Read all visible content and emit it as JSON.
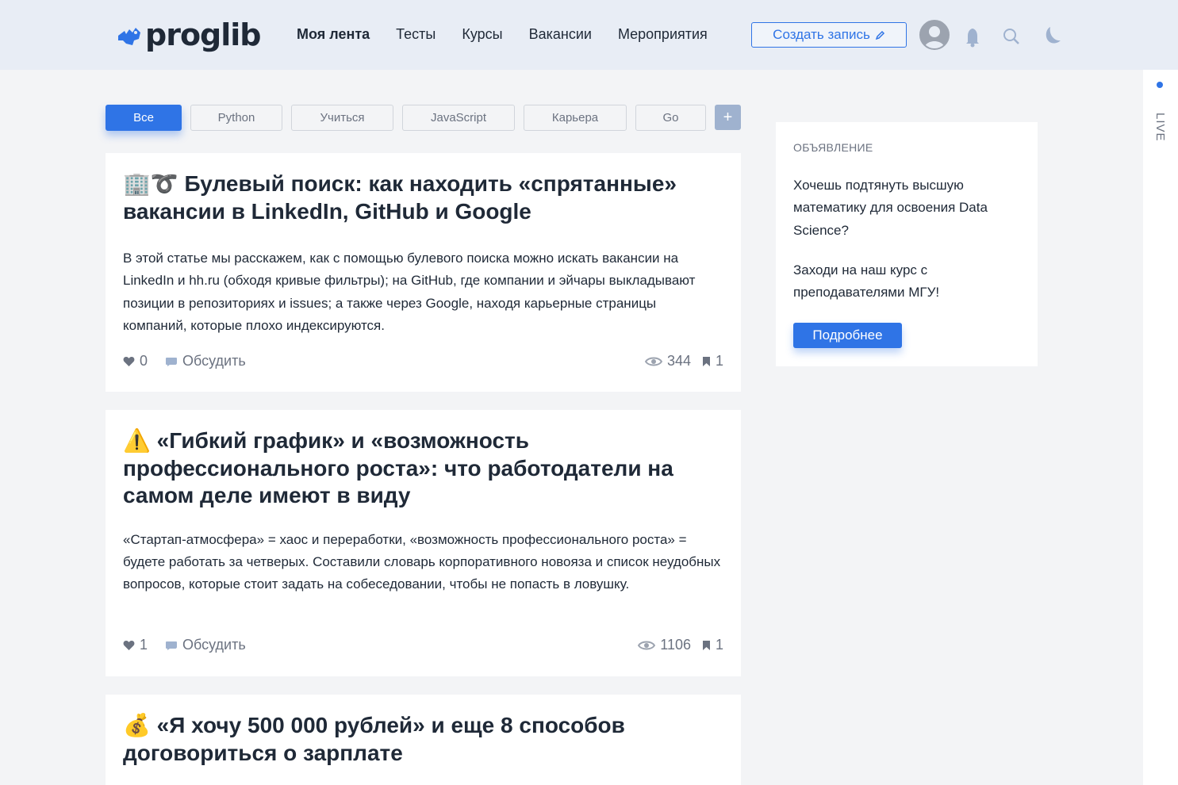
{
  "header": {
    "logo_text": "proglib",
    "nav": [
      "Моя лента",
      "Тесты",
      "Курсы",
      "Вакансии",
      "Мероприятия"
    ],
    "create_label": "Создать запись",
    "icons": [
      "avatar-icon",
      "bell-icon",
      "search-icon",
      "moon-icon",
      "pencil-icon"
    ]
  },
  "tabs": {
    "items": [
      "Все",
      "Python",
      "Учиться",
      "JavaScript",
      "Карьера",
      "Go"
    ],
    "add_label": "+"
  },
  "posts": [
    {
      "emoji": "🏢➰",
      "title": "Булевый поиск: как находить «спрятанные» вакансии в LinkedIn, GitHub и Google",
      "text": "В этой статье мы расскажем, как с помощью булевого поиска можно искать вакансии на LinkedIn и hh.ru (обходя кривые фильтры); на GitHub, где компании и эйчары выкладывают позиции в репозиториях и issues; а также через Google, находя карьерные страницы компаний, которые плохо индексируются.",
      "likes": "0",
      "discuss": "Обсудить",
      "views": "344",
      "bookmarks": "1"
    },
    {
      "emoji": "⚠️",
      "title": "«Гибкий график» и «возможность профессионального роста»: что работодатели на самом деле имеют в виду",
      "text": "«Стартап-атмосфера» = хаос и переработки, «возможность профессионального роста» = будете работать за четверых. Составили словарь корпоративного новояза и список неудобных вопросов, которые стоит задать на собеседовании, чтобы не попасть в ловушку.",
      "likes": "1",
      "discuss": "Обсудить",
      "views": "1106",
      "bookmarks": "1"
    },
    {
      "emoji": "💰",
      "title": "«Я хочу 500 000 рублей» и еще 8 способов договориться о зарплате"
    }
  ],
  "ad": {
    "label": "ОБЪЯВЛЕНИЕ",
    "text1": "Хочешь подтянуть высшую математику для освоения Data Science?",
    "text2": "Заходи на наш курс с преподавателями МГУ!",
    "button": "Подробнее"
  },
  "live": {
    "label": "LIVE"
  },
  "colors": {
    "accent": "#2f74e6",
    "header_bg": "#e8edf5",
    "page_bg": "#f3f4f6"
  }
}
